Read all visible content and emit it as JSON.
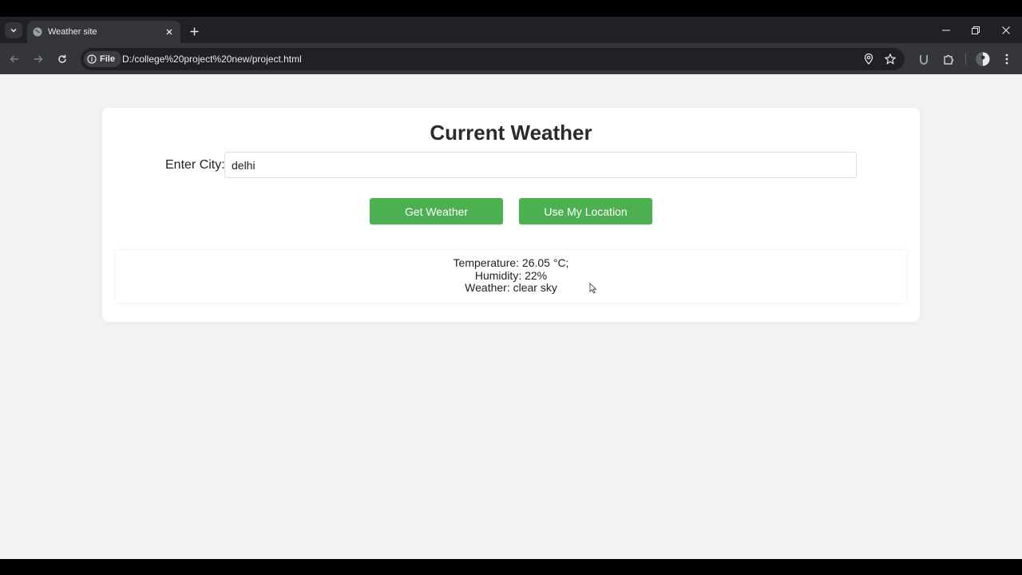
{
  "browser": {
    "tab_title": "Weather site",
    "site_chip_label": "File",
    "url": "D:/college%20project%20new/project.html"
  },
  "page": {
    "title": "Current Weather",
    "city_label": "Enter City:",
    "city_value": "delhi",
    "get_weather_button": "Get Weather",
    "use_location_button": "Use My Location",
    "result": {
      "temperature": "Temperature: 26.05 °C;",
      "humidity": "Humidity: 22%",
      "weather": "Weather: clear sky"
    }
  },
  "colors": {
    "button_green": "#4caf50",
    "page_background": "#f3f3f5",
    "chrome_dark": "#202124",
    "chrome_toolbar": "#35363a"
  }
}
